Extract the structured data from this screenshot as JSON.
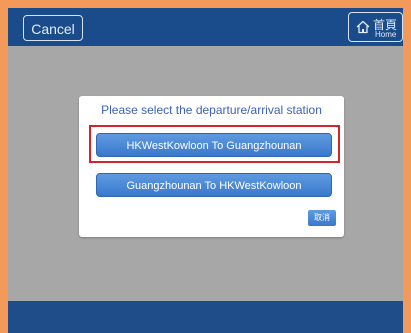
{
  "header": {
    "cancel_label": "Cancel",
    "home_label_cn": "首頁",
    "home_label_en": "Home"
  },
  "dialog": {
    "title": "Please select the departure/arrival station",
    "options": [
      {
        "label": "HKWestKowloon   To   Guangzhounan"
      },
      {
        "label": "Guangzhounan   To   HKWestKowloon"
      }
    ],
    "close_label": "取消"
  },
  "colors": {
    "outer_border": "#f39a5b",
    "bar_blue": "#1a4c8c",
    "button_blue": "#4a88d6",
    "highlight": "#d4232a"
  }
}
